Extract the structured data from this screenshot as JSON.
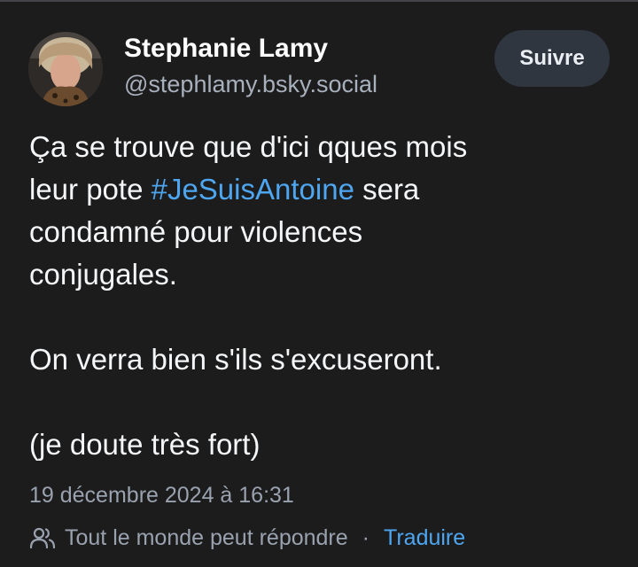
{
  "author": {
    "name": "Stephanie Lamy",
    "handle": "@stephlamy.bsky.social",
    "avatar_icon": "profile-photo"
  },
  "follow_button": {
    "label": "Suivre"
  },
  "post": {
    "line1": "Ça se trouve que d'ici qques mois",
    "line2_before": "leur pote ",
    "hashtag": "#JeSuisAntoine",
    "line2_after": " sera",
    "line3": "condamné pour violences",
    "line4": "conjugales.",
    "line5": "On verra bien s'ils s'excuseront.",
    "line6": "(je doute très fort)"
  },
  "timestamp": "19 décembre 2024 à 16:31",
  "reply_setting": {
    "icon": "people-icon",
    "label": "Tout le monde peut répondre"
  },
  "separator": "·",
  "translate_link": "Traduire",
  "colors": {
    "background": "#1c1c1d",
    "link": "#4ea6f0",
    "secondary_text": "#99a2ae",
    "button_bg": "#2f3640"
  }
}
